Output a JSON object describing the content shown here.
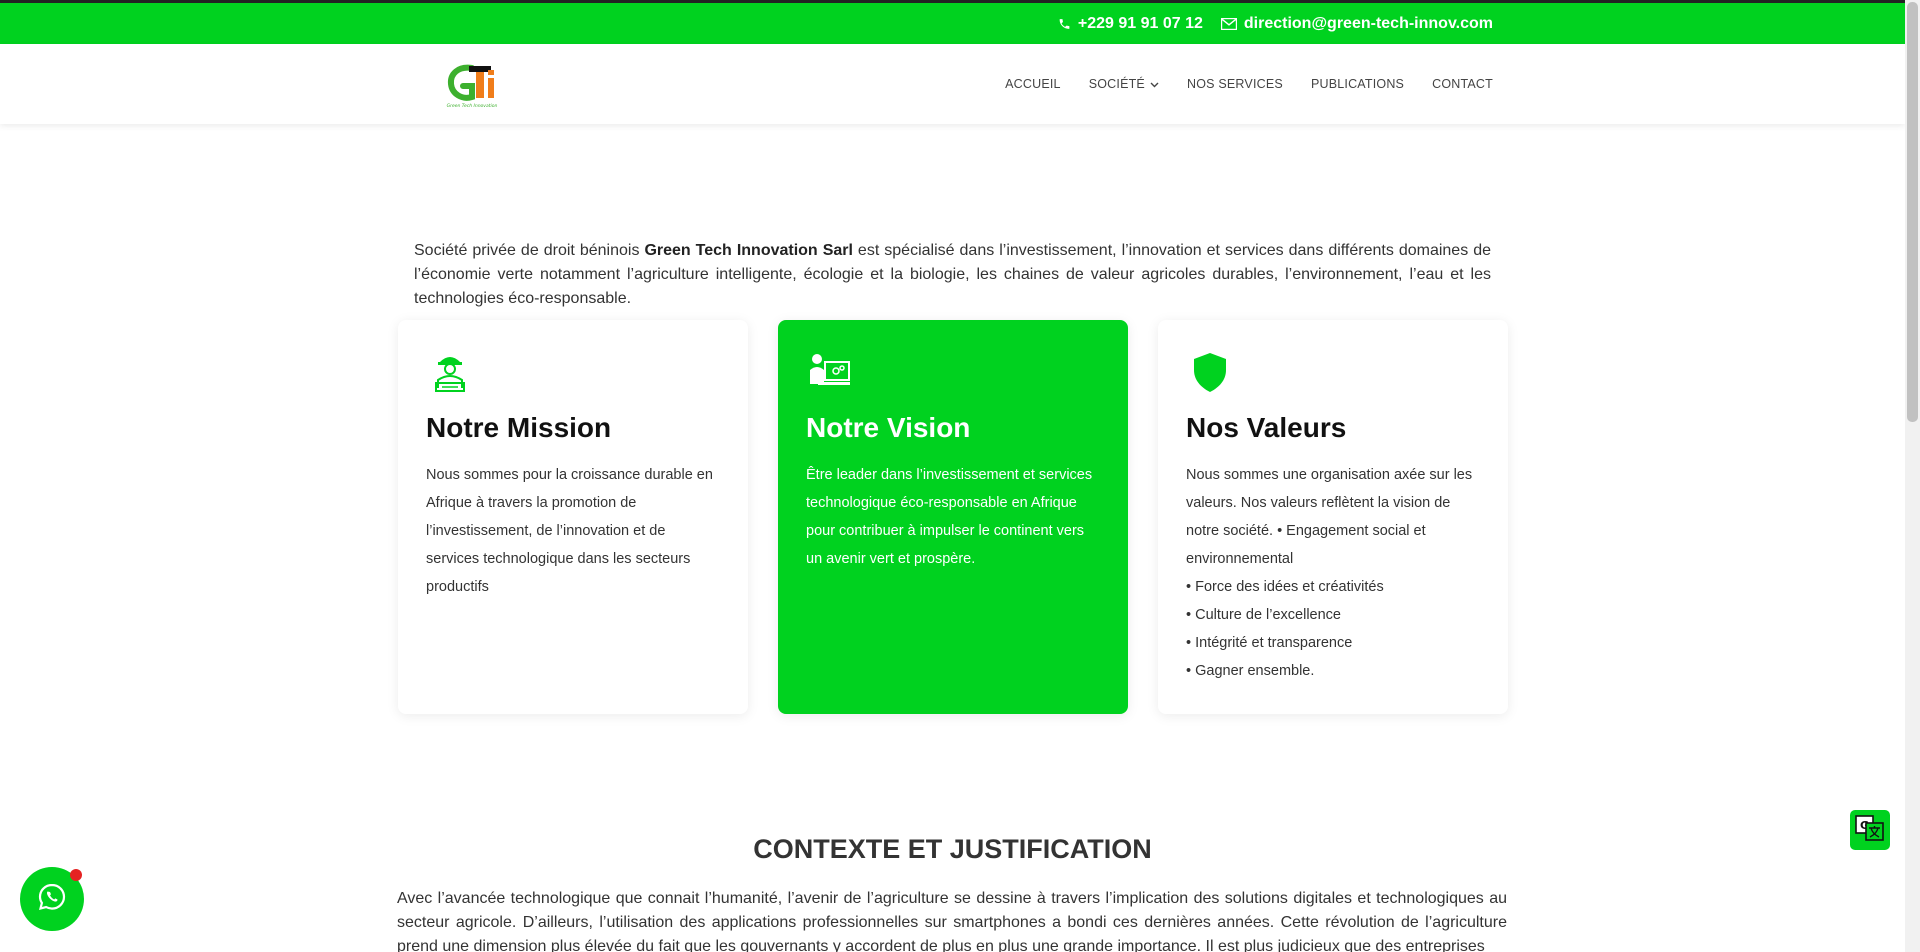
{
  "topbar": {
    "phone": "+229 91 91 07 12",
    "email": "direction@green-tech-innov.com",
    "phone_icon": "phone-icon",
    "email_icon": "envelope-icon"
  },
  "header": {
    "logo_text": "GTi",
    "logo_subtext": "Green Tech Innovation",
    "nav": [
      {
        "label": "ACCUEIL"
      },
      {
        "label": "SOCIÉTÉ"
      },
      {
        "label": "NOS SERVICES"
      },
      {
        "label": "PUBLICATIONS"
      },
      {
        "label": "CONTACT"
      }
    ]
  },
  "intro": {
    "prefix": "Société privée de droit béninois ",
    "company": "Green Tech Innovation Sarl",
    "suffix": " est spécialisé dans l’investissement, l’innovation et services dans différents domaines de l’économie verte notamment l’agriculture intelligente, écologie et la biologie, les chaines de valeur agricoles durables, l’environnement, l’eau et les technologies éco-responsable."
  },
  "cards": [
    {
      "title": "Notre Mission",
      "icon": "engineer-icon",
      "text": "Nous sommes pour la croissance durable en Afrique à travers la promotion de l’investissement, de l’innovation et de services technologique dans les secteurs productifs"
    },
    {
      "title": "Notre Vision",
      "icon": "computer-user-icon",
      "text": "Être leader dans l’investissement et services technologique éco-responsable en Afrique pour contribuer à impulser le continent vers un avenir vert et prospère."
    },
    {
      "title": "Nos Valeurs",
      "icon": "shield-icon",
      "text_lines": [
        "Nous sommes une organisation axée sur les valeurs. Nos valeurs reflètent la vision de notre société. • Engagement social et environnemental",
        "• Force des idées et créativités",
        "• Culture de l’excellence",
        "• Intégrité et transparence",
        "• Gagner ensemble."
      ]
    }
  ],
  "context": {
    "title": "CONTEXTE ET JUSTIFICATION",
    "body": "Avec l’avancée technologique que connait l’humanité, l’avenir de l’agriculture se dessine à travers l’implication des solutions digitales et technologiques au secteur agricole. D’ailleurs, l’utilisation des applications professionnelles sur smartphones a bondi ces dernières années. Cette révolution de l’agriculture prend une dimension plus élevée du fait que les gouvernants y accordent de plus en plus une grande importance. Il est plus judicieux que des entreprises"
  },
  "widgets": {
    "whatsapp_icon": "whatsapp-icon",
    "translate_icon": "translate-icon"
  },
  "colors": {
    "brand_green": "#00d21f",
    "brand_orange": "#f07d1a",
    "badge_red": "#e52222"
  }
}
